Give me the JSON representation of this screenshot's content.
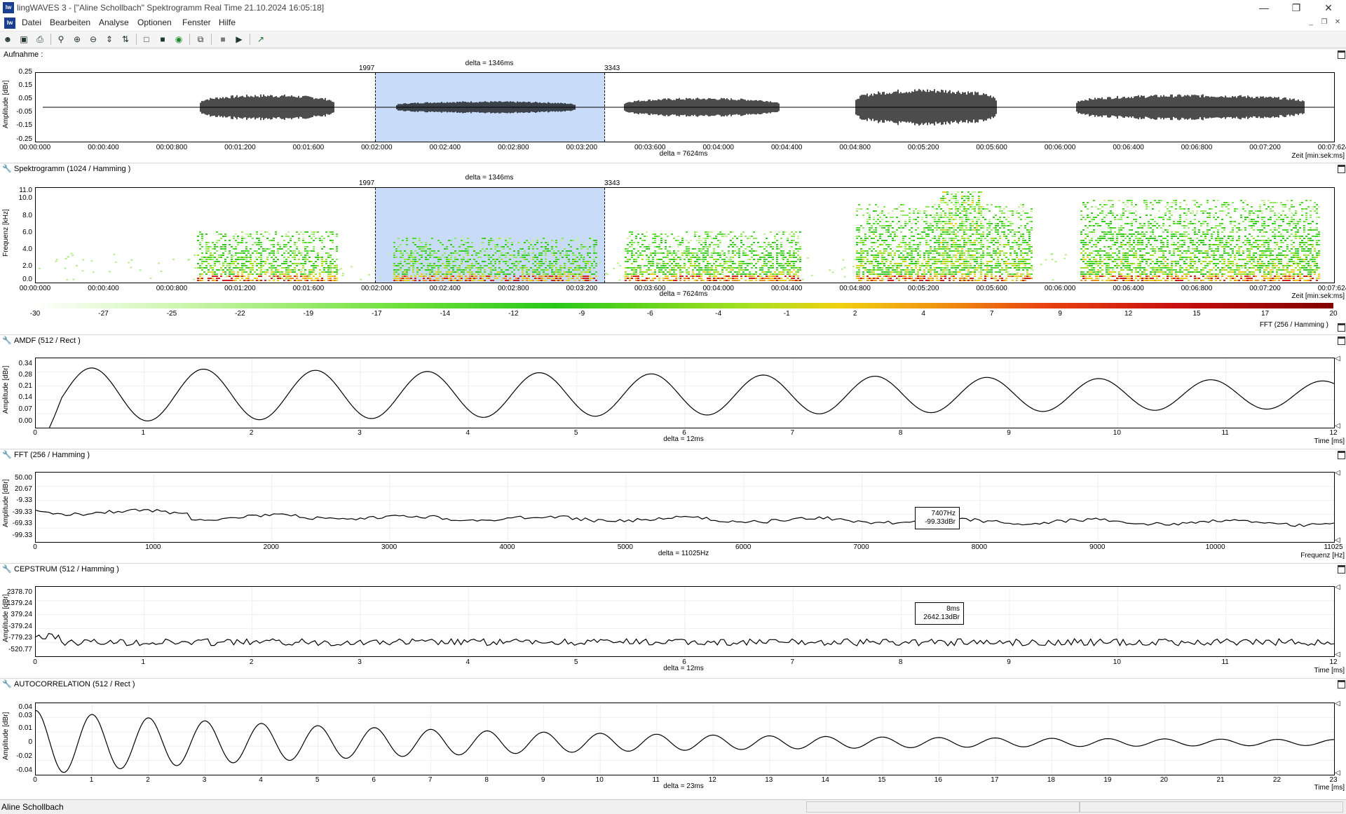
{
  "window": {
    "title": "lingWAVES 3 - [\"Aline Schollbach\" Spektrogramm Real Time  21.10.2024 16:05:18]",
    "app_icon": "lw-logo-icon",
    "controls": [
      "minimize-icon",
      "restore-icon",
      "close-icon"
    ]
  },
  "menu": {
    "items": [
      "Datei",
      "Bearbeiten",
      "Analyse",
      "Optionen",
      "Fenster",
      "Hilfe"
    ]
  },
  "toolbar": {
    "icons": [
      "patient-icon",
      "save-icon",
      "print-icon",
      "zoom-fit-icon",
      "zoom-in-icon",
      "zoom-out-icon",
      "expand-vertical-icon",
      "compress-vertical-icon",
      "select-icon",
      "select-all-icon",
      "record-icon",
      "copy-icon",
      "stop-icon",
      "play-icon",
      "export-icon"
    ]
  },
  "colors": {
    "selection": "#c8dcfa",
    "waveform": "#000000",
    "spectro_low": "#8ee84c",
    "spectro_mid": "#e8d020",
    "spectro_high": "#c01818"
  },
  "panels": {
    "recording": {
      "title": "Aufnahme :",
      "ylabel": "Amplitude [dBr]",
      "yticks": [
        "0.25",
        "0.15",
        "0.05",
        "-0.05",
        "-0.15",
        "-0.25"
      ],
      "xticks": [
        "00:00:000",
        "00:00:400",
        "00:00:800",
        "00:01:200",
        "00:01:600",
        "00:02:000",
        "00:02:400",
        "00:02:800",
        "00:03:200",
        "00:03:600",
        "00:04:000",
        "00:04:400",
        "00:04:800",
        "00:05:200",
        "00:05:600",
        "00:06:000",
        "00:06:400",
        "00:06:800",
        "00:07:200",
        "00:07:624"
      ],
      "x_unit": "Zeit [min:sek:ms]",
      "delta_sel": "delta = 1346ms",
      "delta_total": "delta = 7624ms",
      "sel_start": "1997",
      "sel_end": "3343"
    },
    "spectrogram": {
      "title": "Spektrogramm (1024 / Hamming )",
      "ylabel": "Frequenz [kHz]",
      "yticks": [
        "11.0",
        "10.0",
        "8.0",
        "6.0",
        "4.0",
        "2.0",
        "0.0"
      ],
      "xticks": [
        "00:00:000",
        "00:00:400",
        "00:00:800",
        "00:01:200",
        "00:01:600",
        "00:02:000",
        "00:02:400",
        "00:02:800",
        "00:03:200",
        "00:03:600",
        "00:04:000",
        "00:04:400",
        "00:04:800",
        "00:05:200",
        "00:05:600",
        "00:06:000",
        "00:06:400",
        "00:06:800",
        "00:07:200",
        "00:07:624"
      ],
      "x_unit": "Zeit [min:sek:ms]",
      "delta_sel": "delta = 1346ms",
      "delta_total": "delta = 7624ms",
      "sel_start": "1997",
      "sel_end": "3343",
      "colorbar_ticks": [
        "-30",
        "-27",
        "-25",
        "-22",
        "-19",
        "-17",
        "-14",
        "-12",
        "-9",
        "-6",
        "-4",
        "-1",
        "2",
        "4",
        "7",
        "9",
        "12",
        "15",
        "17",
        "20"
      ],
      "colorbar_label": "FFT (256 / Hamming )"
    },
    "amdf": {
      "title": "AMDF (512 / Rect )",
      "ylabel": "Amplitude [dBr]",
      "yticks": [
        "0.34",
        "0.28",
        "0.21",
        "0.14",
        "0.07",
        "0.00"
      ],
      "xticks": [
        "0",
        "1",
        "2",
        "3",
        "4",
        "5",
        "6",
        "7",
        "8",
        "9",
        "10",
        "11",
        "12"
      ],
      "x_unit": "Time [ms]",
      "delta": "delta = 12ms"
    },
    "fft": {
      "title": "FFT (256 / Hamming )",
      "ylabel": "Amplitude [dBr]",
      "yticks": [
        "50.00",
        "20.67",
        "-9.33",
        "-39.33",
        "-69.33",
        "-99.33"
      ],
      "xticks": [
        "0",
        "1000",
        "2000",
        "3000",
        "4000",
        "5000",
        "6000",
        "7000",
        "8000",
        "9000",
        "10000",
        "11025"
      ],
      "x_unit": "Frequenz [Hz]",
      "delta": "delta = 11025Hz",
      "tooltip_line1": "7407Hz",
      "tooltip_line2": "-99.33dBr"
    },
    "cepstrum": {
      "title": "CEPSTRUM (512 / Hamming )",
      "ylabel": "Amplitude [dBr]",
      "yticks": [
        "2378.70",
        "1379.24",
        "379.24",
        "-379.24",
        "-779.23",
        "-520.77"
      ],
      "xticks": [
        "0",
        "1",
        "2",
        "3",
        "4",
        "5",
        "6",
        "7",
        "8",
        "9",
        "10",
        "11",
        "12"
      ],
      "x_unit": "Time [ms]",
      "delta": "delta = 12ms",
      "tooltip_line1": "8ms",
      "tooltip_line2": "2642.13dBr"
    },
    "autocorrelation": {
      "title": "AUTOCORRELATION (512 / Rect )",
      "ylabel": "Amplitude [dBr]",
      "yticks": [
        "0.04",
        "0.03",
        "0.01",
        "0",
        "-0.02",
        "-0.04"
      ],
      "xticks": [
        "0",
        "1",
        "2",
        "3",
        "4",
        "5",
        "6",
        "7",
        "8",
        "9",
        "10",
        "11",
        "12",
        "13",
        "14",
        "15",
        "16",
        "17",
        "18",
        "19",
        "20",
        "21",
        "22",
        "23"
      ],
      "x_unit": "Time [ms]",
      "delta": "delta = 23ms"
    }
  },
  "status": {
    "user": "Aline Schollbach"
  }
}
